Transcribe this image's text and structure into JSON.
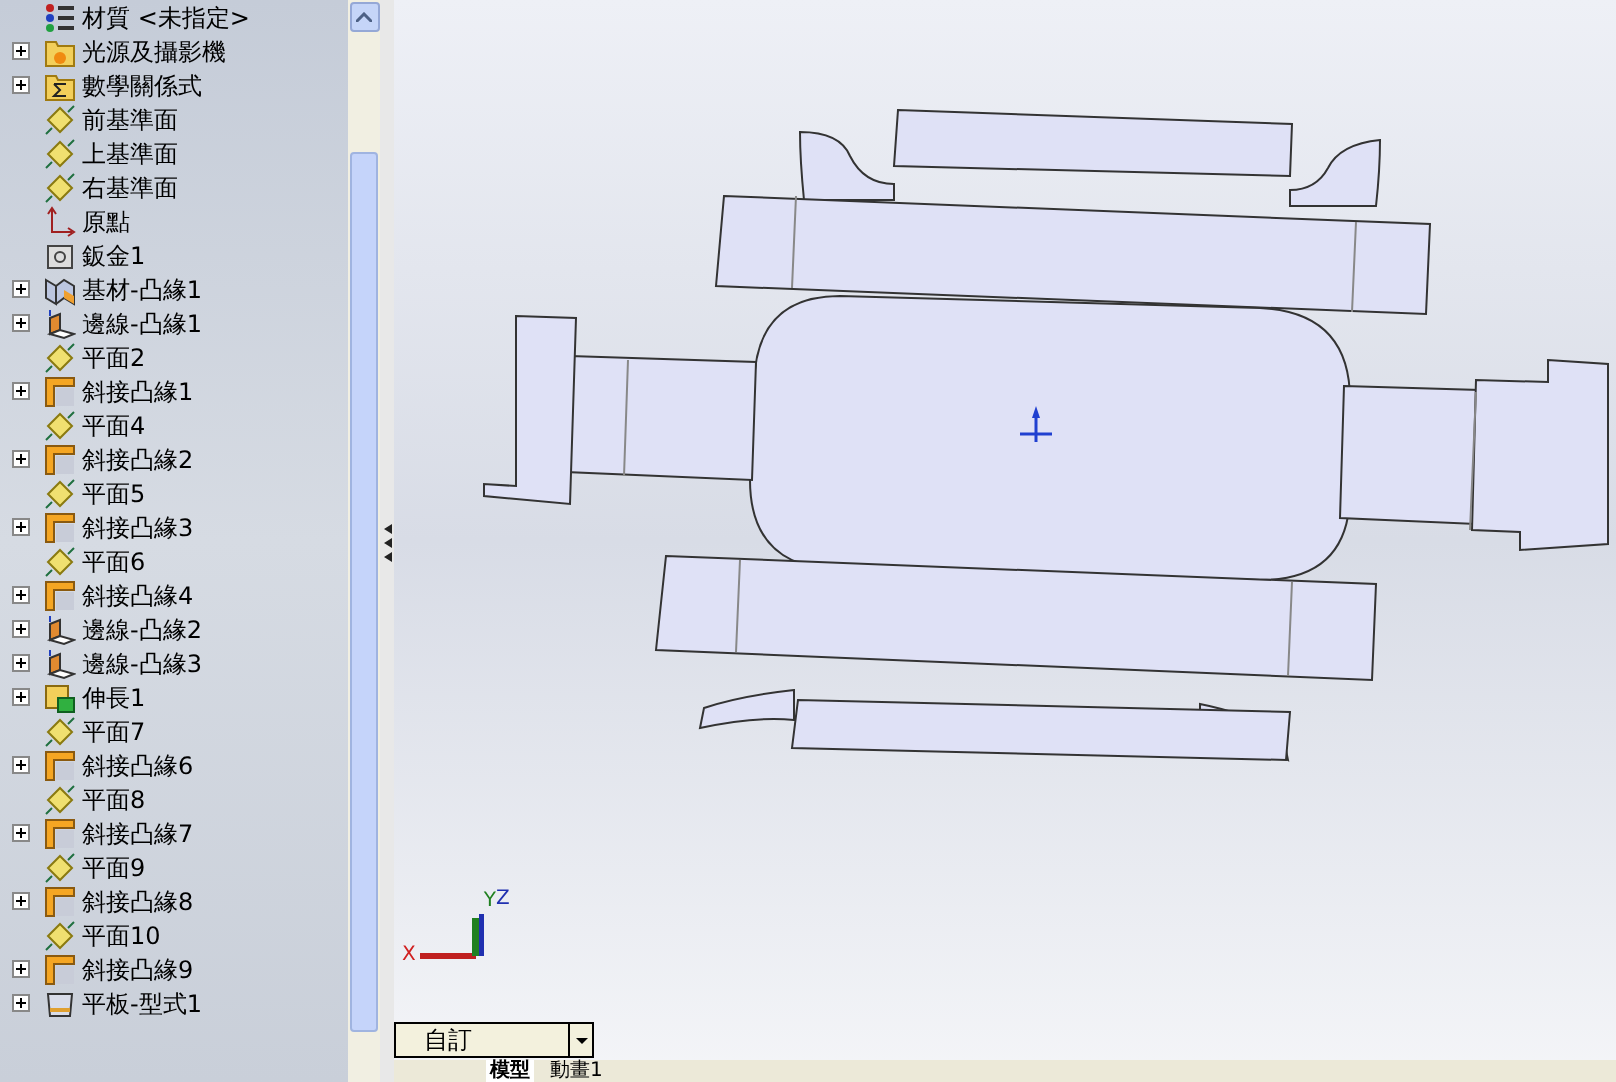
{
  "feature_tree": {
    "items": [
      {
        "label": "材質 <未指定>",
        "kind": "material",
        "expandable": false
      },
      {
        "label": "光源及攝影機",
        "kind": "lights",
        "expandable": true
      },
      {
        "label": "數學關係式",
        "kind": "equations",
        "expandable": true
      },
      {
        "label": "前基準面",
        "kind": "plane",
        "expandable": false
      },
      {
        "label": "上基準面",
        "kind": "plane",
        "expandable": false
      },
      {
        "label": "右基準面",
        "kind": "plane",
        "expandable": false
      },
      {
        "label": "原點",
        "kind": "origin",
        "expandable": false
      },
      {
        "label": "鈑金1",
        "kind": "sheetmetal",
        "expandable": false
      },
      {
        "label": "基材-凸緣1",
        "kind": "base-flange",
        "expandable": true
      },
      {
        "label": "邊線-凸緣1",
        "kind": "edge-flange",
        "expandable": true
      },
      {
        "label": "平面2",
        "kind": "plane",
        "expandable": false
      },
      {
        "label": "斜接凸緣1",
        "kind": "miter-flange",
        "expandable": true
      },
      {
        "label": "平面4",
        "kind": "plane",
        "expandable": false
      },
      {
        "label": "斜接凸緣2",
        "kind": "miter-flange",
        "expandable": true
      },
      {
        "label": "平面5",
        "kind": "plane",
        "expandable": false
      },
      {
        "label": "斜接凸緣3",
        "kind": "miter-flange",
        "expandable": true
      },
      {
        "label": "平面6",
        "kind": "plane",
        "expandable": false
      },
      {
        "label": "斜接凸緣4",
        "kind": "miter-flange",
        "expandable": true
      },
      {
        "label": "邊線-凸緣2",
        "kind": "edge-flange",
        "expandable": true
      },
      {
        "label": "邊線-凸緣3",
        "kind": "edge-flange",
        "expandable": true
      },
      {
        "label": "伸長1",
        "kind": "extrude",
        "expandable": true
      },
      {
        "label": "平面7",
        "kind": "plane",
        "expandable": false
      },
      {
        "label": "斜接凸緣6",
        "kind": "miter-flange",
        "expandable": true
      },
      {
        "label": "平面8",
        "kind": "plane",
        "expandable": false
      },
      {
        "label": "斜接凸緣7",
        "kind": "miter-flange",
        "expandable": true
      },
      {
        "label": "平面9",
        "kind": "plane",
        "expandable": false
      },
      {
        "label": "斜接凸緣8",
        "kind": "miter-flange",
        "expandable": true
      },
      {
        "label": "平面10",
        "kind": "plane",
        "expandable": false
      },
      {
        "label": "斜接凸緣9",
        "kind": "miter-flange",
        "expandable": true
      },
      {
        "label": "平板-型式1",
        "kind": "flat-pattern",
        "expandable": true
      }
    ]
  },
  "triad": {
    "x": "X",
    "y": "Y",
    "z": "Z"
  },
  "configuration": {
    "value": "自訂"
  },
  "bottom_tabs": [
    {
      "label": "模型",
      "selected": true
    },
    {
      "label": "動畫1",
      "selected": false
    }
  ]
}
